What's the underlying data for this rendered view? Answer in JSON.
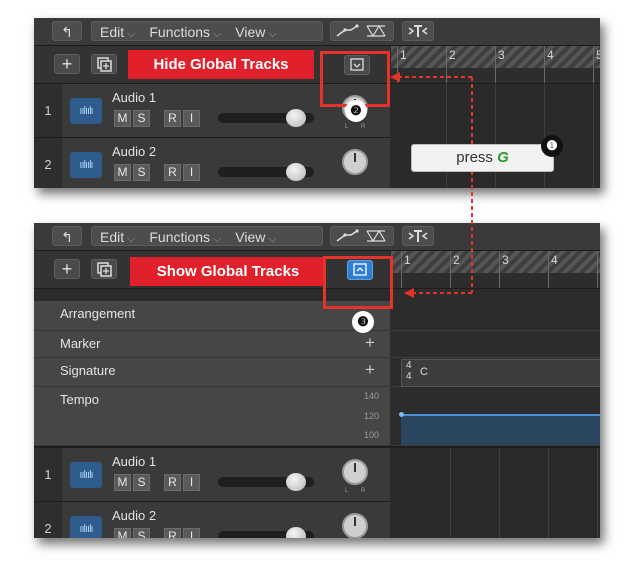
{
  "toolbar": {
    "back_glyph": "↰",
    "edit_label": "Edit",
    "functions_label": "Functions",
    "view_label": "View",
    "chevron": "⌵"
  },
  "panel1": {
    "banner_text": "Hide Global Tracks",
    "add_glyph": "+",
    "ruler_numbers": [
      "1",
      "2",
      "3",
      "4",
      "5"
    ],
    "tracks": [
      {
        "number": "1",
        "name": "Audio 1"
      },
      {
        "number": "2",
        "name": "Audio 2"
      }
    ]
  },
  "panel2": {
    "banner_text": "Show Global Tracks",
    "add_glyph": "+",
    "ruler_numbers": [
      "1",
      "2",
      "3",
      "4",
      "5"
    ],
    "global_tracks": [
      {
        "label": "Arrangement"
      },
      {
        "label": "Marker"
      },
      {
        "label": "Signature"
      },
      {
        "label": "Tempo"
      }
    ],
    "signature_region": {
      "numerator": "4",
      "denominator": "4",
      "key": "C"
    },
    "tempo_scale": [
      "140",
      "120",
      "100"
    ],
    "tracks": [
      {
        "number": "1",
        "name": "Audio 1"
      },
      {
        "number": "2",
        "name": "Audio 2"
      }
    ]
  },
  "buttons": {
    "m": "M",
    "s": "S",
    "r": "R",
    "i": "I"
  },
  "pan_labels": {
    "left": "L",
    "right": "R"
  },
  "callout": {
    "prefix": "press",
    "key": "G"
  },
  "badges": [
    "❶",
    "❷",
    "❸"
  ],
  "colors": {
    "banner": "#e0202b",
    "highlight": "#e5322a",
    "key_green": "#2c9a2c",
    "tempo_line": "#4a90d9"
  }
}
